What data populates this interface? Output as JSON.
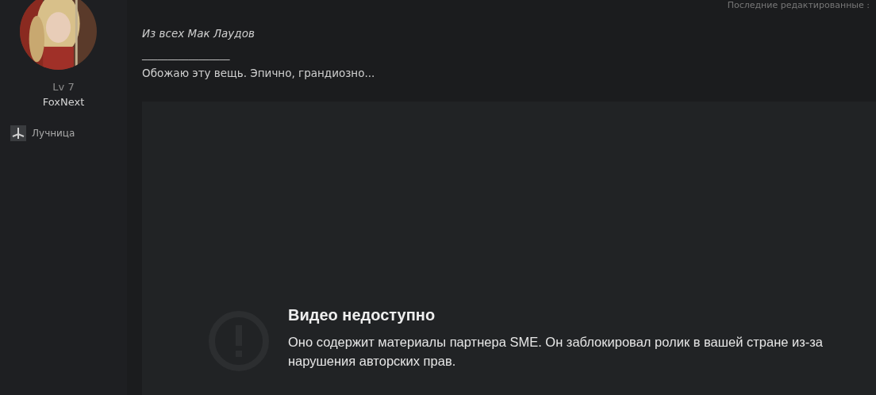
{
  "header": {
    "edited_note": "Последние редактированные :"
  },
  "author": {
    "level": "Lv 7",
    "name": "FoxNext",
    "class": "Лучница"
  },
  "post": {
    "quote": "Из всех Мак Лаудов",
    "separator": "_________________",
    "text": "Обожаю эту вещь. Эпично, грандиозно...",
    "video": {
      "title": "Видео недоступно",
      "message": "Оно содержит материалы партнера SME. Он заблокировал ролик в вашей стране из-за нарушения авторских прав."
    }
  }
}
